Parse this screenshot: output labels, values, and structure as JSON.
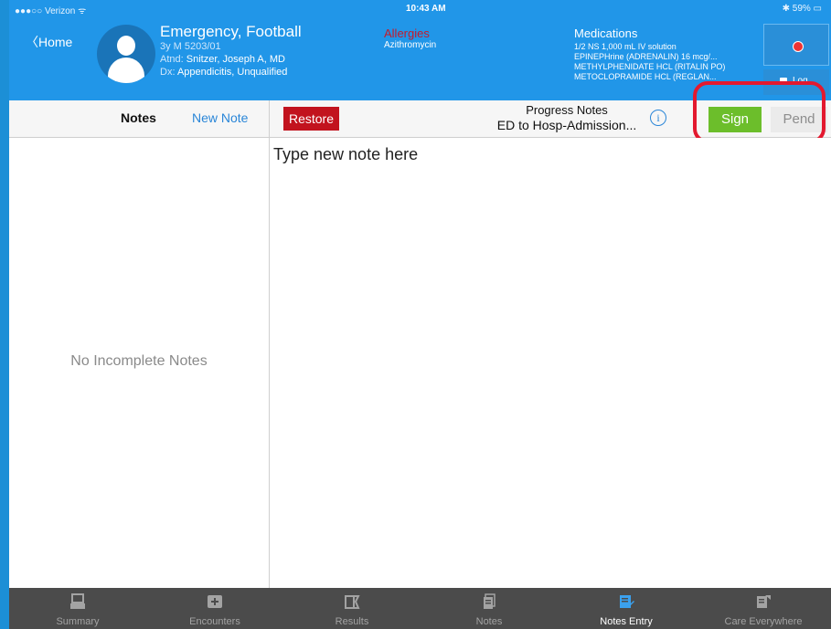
{
  "status": {
    "carrier": "●●●○○ Verizon ᯤ",
    "time": "10:43 AM",
    "battery": "✱ 59% ▭"
  },
  "header": {
    "home_label": "〈Home",
    "patient": {
      "name": "Emergency, Football",
      "demographics": "3y M  5203/01",
      "attending_label": "Atnd:",
      "attending_value": "Snitzer, Joseph A, MD",
      "dx_label": "Dx:",
      "dx_value": "Appendicitis, Unqualified"
    },
    "allergies": {
      "title": "Allergies",
      "items": [
        "Azithromycin"
      ]
    },
    "medications": {
      "title": "Medications",
      "items": [
        "1/2 NS 1,000 mL IV solution",
        "EPINEPHrine (ADRENALIN) 16 mcg/...",
        "METHYLPHENIDATE HCL (RITALIN PO)",
        "METOCLOPRAMIDE HCL (REGLAN..."
      ]
    },
    "log_label": "Log..."
  },
  "toolbar": {
    "notes_label": "Notes",
    "new_note_label": "New Note",
    "restore_label": "Restore",
    "note_type": "Progress Notes",
    "note_context": "ED to Hosp-Admission...",
    "info_glyph": "i",
    "sign_label": "Sign",
    "pend_label": "Pend"
  },
  "notes_list": {
    "empty_message": "No Incomplete Notes"
  },
  "editor": {
    "placeholder": "Type new note here"
  },
  "tabs": [
    {
      "label": "Summary",
      "icon": "summary-icon",
      "active": false
    },
    {
      "label": "Encounters",
      "icon": "encounters-icon",
      "active": false
    },
    {
      "label": "Results",
      "icon": "results-icon",
      "active": false
    },
    {
      "label": "Notes",
      "icon": "notes-icon",
      "active": false
    },
    {
      "label": "Notes Entry",
      "icon": "notes-entry-icon",
      "active": true
    },
    {
      "label": "Care Everywhere",
      "icon": "care-everywhere-icon",
      "active": false
    }
  ],
  "colors": {
    "header_blue": "#2196e8",
    "restore_red": "#c2131e",
    "sign_green": "#6cbe2b",
    "highlight_red": "#e3192f",
    "tabbar_gray": "#4b4b4b",
    "active_tab_icon": "#3ba1ee"
  }
}
